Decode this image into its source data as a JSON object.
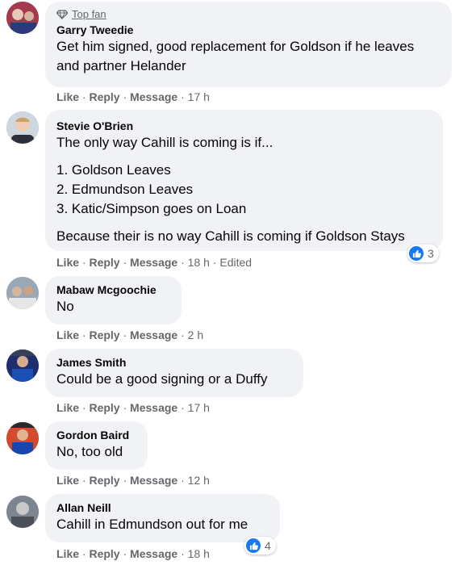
{
  "comments": [
    {
      "badge": "Top fan",
      "name": "Garry Tweedie",
      "text": "Get him signed, good replacement for Goldson if he leaves and partner Helander",
      "actions": {
        "like": "Like",
        "reply": "Reply",
        "message": "Message",
        "time": "17 h"
      }
    },
    {
      "name": "Stevie O'Brien",
      "paragraphs": [
        "The only way Cahill is coming is if...",
        "1. Goldson Leaves",
        "2. Edmundson Leaves",
        "3. Katic/Simpson goes on Loan",
        "Because their is no way Cahill is coming if Goldson Stays"
      ],
      "reaction_count": "3",
      "actions": {
        "like": "Like",
        "reply": "Reply",
        "message": "Message",
        "time": "18 h",
        "edited": "Edited"
      }
    },
    {
      "name": "Mabaw Mcgoochie",
      "text": "No",
      "actions": {
        "like": "Like",
        "reply": "Reply",
        "message": "Message",
        "time": "2 h"
      }
    },
    {
      "name": "James Smith",
      "text": "Could be a good signing or a Duffy",
      "actions": {
        "like": "Like",
        "reply": "Reply",
        "message": "Message",
        "time": "17 h"
      }
    },
    {
      "name": "Gordon Baird",
      "text": "No, too old",
      "actions": {
        "like": "Like",
        "reply": "Reply",
        "message": "Message",
        "time": "12 h"
      }
    },
    {
      "name": "Allan Neill",
      "text": "Cahill in Edmundson out for me",
      "reaction_count": "4",
      "actions": {
        "like": "Like",
        "reply": "Reply",
        "message": "Message",
        "time": "18 h"
      }
    }
  ],
  "icons": {
    "badge": "diamond-icon",
    "reaction": "thumbs-up-icon"
  },
  "colors": {
    "bubble": "#f0f2f5",
    "muted": "#65676b",
    "like_blue": "#1877f2"
  }
}
